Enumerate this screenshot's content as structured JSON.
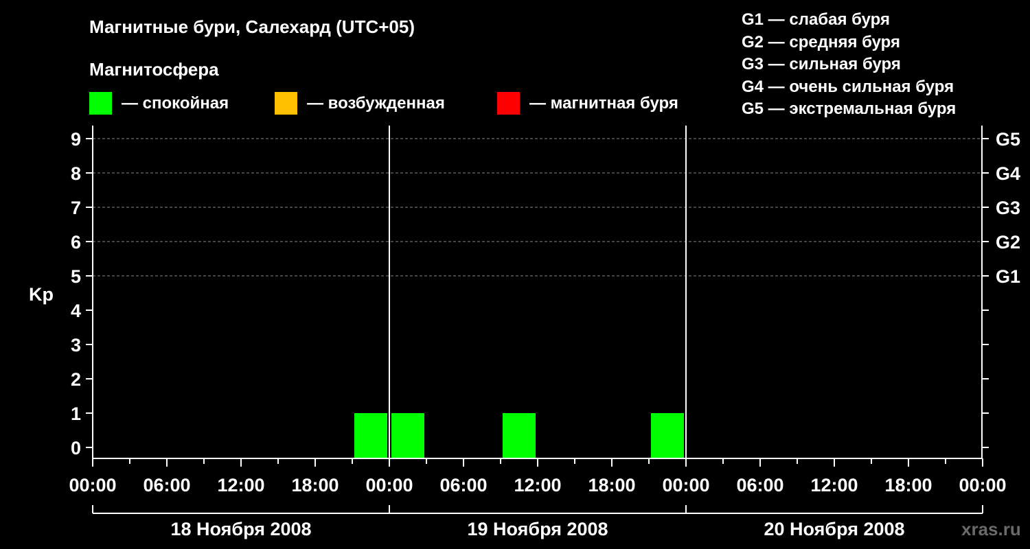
{
  "chart_data": {
    "type": "bar",
    "title": "Магнитные бури, Салехард (UTC+05)",
    "ylabel": "Kp",
    "xlabel": "",
    "ylim": [
      0,
      9
    ],
    "y_ticks": [
      "0",
      "1",
      "2",
      "3",
      "4",
      "5",
      "6",
      "7",
      "8",
      "9"
    ],
    "x_range_hours": [
      0,
      72
    ],
    "x_ticks": [
      "00:00",
      "06:00",
      "12:00",
      "18:00",
      "00:00",
      "06:00",
      "12:00",
      "18:00",
      "00:00",
      "06:00",
      "12:00",
      "18:00",
      "00:00"
    ],
    "dates": [
      "18 Ноября 2008",
      "19 Ноября 2008",
      "20 Ноября 2008"
    ],
    "g_scale": [
      {
        "label": "G1",
        "kp": 5
      },
      {
        "label": "G2",
        "kp": 6
      },
      {
        "label": "G3",
        "kp": 7
      },
      {
        "label": "G4",
        "kp": 8
      },
      {
        "label": "G5",
        "kp": 9
      }
    ],
    "grid": true,
    "series": [
      {
        "values": [
          {
            "start_hour": 21,
            "kp": 1,
            "state": "calm"
          },
          {
            "start_hour": 24,
            "kp": 1,
            "state": "calm"
          },
          {
            "start_hour": 33,
            "kp": 1,
            "state": "calm"
          },
          {
            "start_hour": 45,
            "kp": 1,
            "state": "calm"
          }
        ]
      }
    ]
  },
  "legend": {
    "section_title": "Магнитосфера",
    "items": [
      {
        "label": "— спокойная",
        "color": "#00ff00"
      },
      {
        "label": "— возбужденная",
        "color": "#ffc000"
      },
      {
        "label": "— магнитная буря",
        "color": "#ff0000"
      }
    ]
  },
  "g_legend": [
    "G1 — слабая буря",
    "G2 — средняя буря",
    "G3 — сильная буря",
    "G4 — очень сильная буря",
    "G5 — экстремальная буря"
  ],
  "watermark": "xras.ru",
  "colors": {
    "background": "#000000",
    "foreground": "#ffffff",
    "grid": "#888888",
    "calm": "#00ff00",
    "excited": "#ffc000",
    "storm": "#ff0000"
  }
}
